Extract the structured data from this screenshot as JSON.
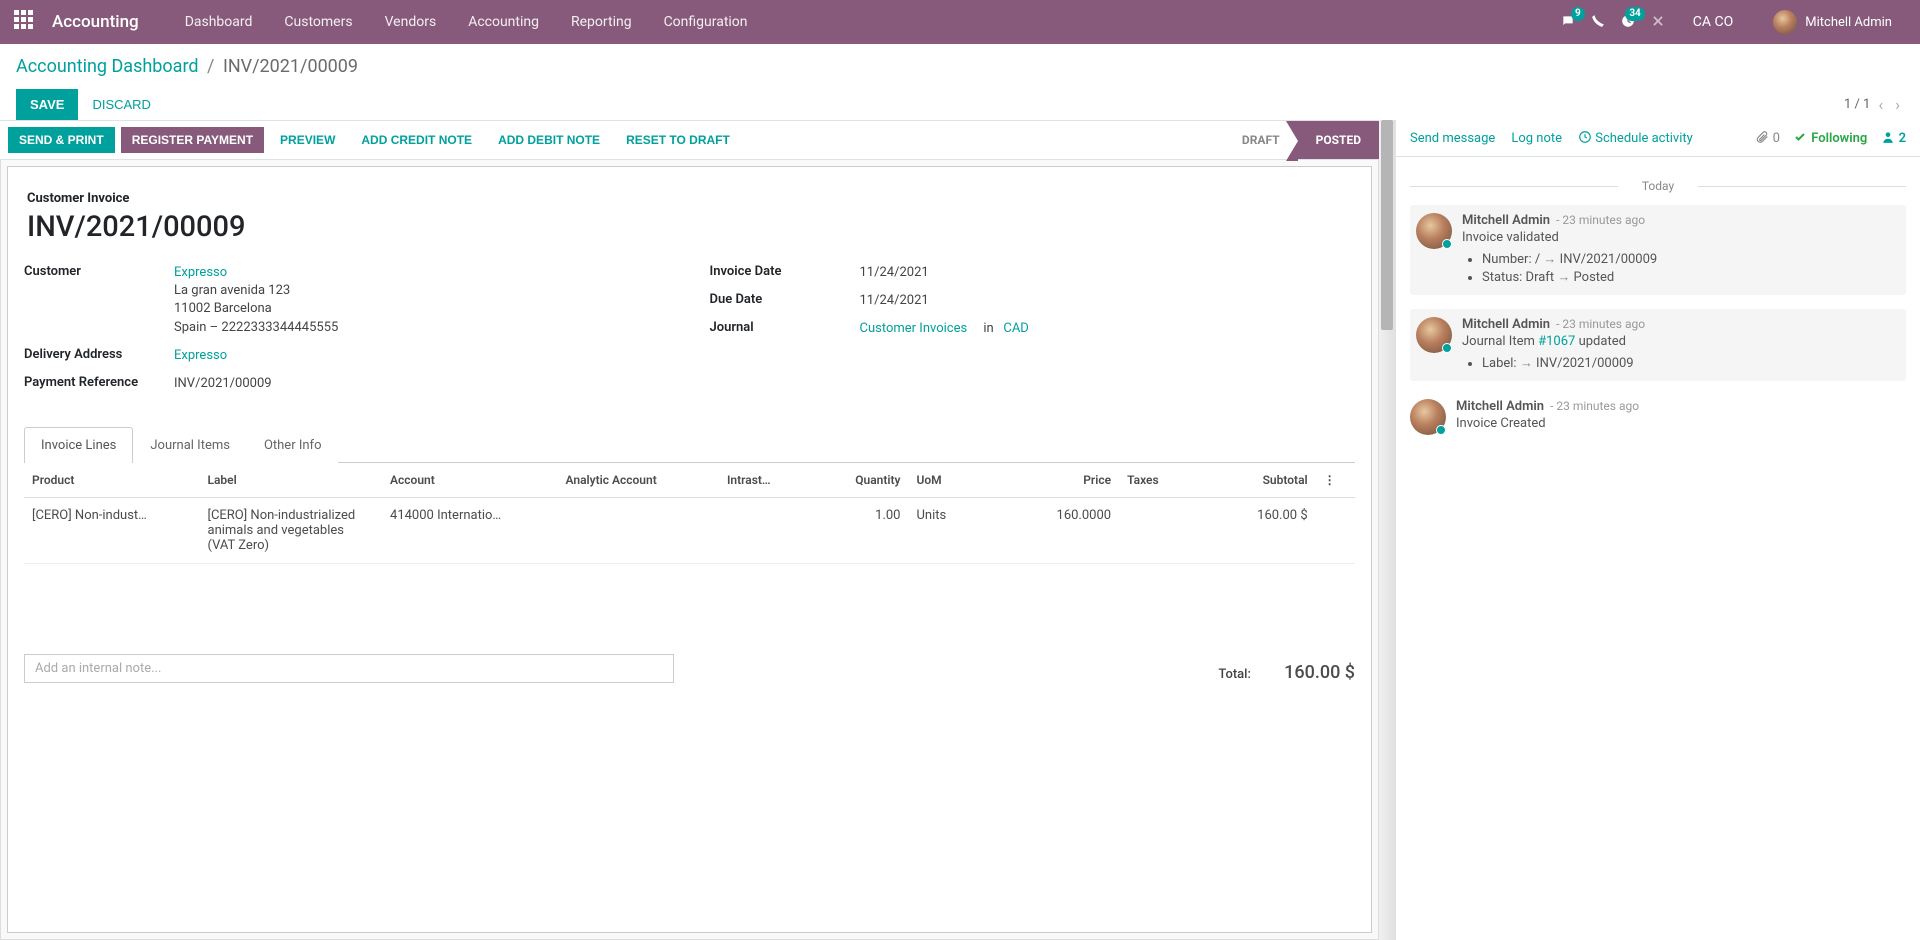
{
  "nav": {
    "app": "Accounting",
    "items": [
      "Dashboard",
      "Customers",
      "Vendors",
      "Accounting",
      "Reporting",
      "Configuration"
    ],
    "messages_count": "9",
    "activities_count": "34",
    "company": "CA CO",
    "user": "Mitchell Admin"
  },
  "breadcrumb": {
    "root": "Accounting Dashboard",
    "current": "INV/2021/00009"
  },
  "cmd": {
    "save": "SAVE",
    "discard": "DISCARD",
    "pager": "1 / 1"
  },
  "status": {
    "buttons": {
      "send_print": "SEND & PRINT",
      "register_payment": "REGISTER PAYMENT",
      "preview": "PREVIEW",
      "add_credit": "ADD CREDIT NOTE",
      "add_debit": "ADD DEBIT NOTE",
      "reset_draft": "RESET TO DRAFT"
    },
    "draft": "DRAFT",
    "posted": "POSTED"
  },
  "sheet": {
    "type": "Customer Invoice",
    "name": "INV/2021/00009",
    "labels": {
      "customer": "Customer",
      "delivery": "Delivery Address",
      "payref": "Payment Reference",
      "invoice_date": "Invoice Date",
      "due_date": "Due Date",
      "journal": "Journal"
    },
    "customer_name": "Expresso",
    "customer_addr1": "La gran avenida 123",
    "customer_addr2": "11002 Barcelona",
    "customer_addr3": "Spain – 2222333344445555",
    "delivery": "Expresso",
    "payref": "INV/2021/00009",
    "invoice_date": "11/24/2021",
    "due_date": "11/24/2021",
    "journal": "Customer Invoices",
    "journal_in": "in",
    "currency": "CAD"
  },
  "tabs": {
    "lines": "Invoice Lines",
    "journal": "Journal Items",
    "other": "Other Info"
  },
  "cols": {
    "product": "Product",
    "label": "Label",
    "account": "Account",
    "analytic": "Analytic Account",
    "intrastat": "Intrast…",
    "quantity": "Quantity",
    "uom": "UoM",
    "price": "Price",
    "taxes": "Taxes",
    "subtotal": "Subtotal"
  },
  "line": {
    "product": "[CERO] Non-indust…",
    "label": "[CERO] Non-industrialized animals and vegetables (VAT Zero)",
    "account": "414000 Internatio…",
    "qty": "1.00",
    "uom": "Units",
    "price": "160.0000",
    "subtotal": "160.00 $"
  },
  "note_placeholder": "Add an internal note...",
  "totals": {
    "label": "Total:",
    "value": "160.00 $"
  },
  "chatter": {
    "send": "Send message",
    "lognote": "Log note",
    "schedule": "Schedule activity",
    "attach_count": "0",
    "following": "Following",
    "followers": "2",
    "today": "Today",
    "msgs": {
      "m1": {
        "author": "Mitchell Admin",
        "time": "- 23 minutes ago",
        "text": "Invoice validated",
        "track1a": "Number: /",
        "track1b": "INV/2021/00009",
        "track2a": "Status: Draft",
        "track2b": "Posted"
      },
      "m2": {
        "author": "Mitchell Admin",
        "time": "- 23 minutes ago",
        "text_a": "Journal Item ",
        "text_link": "#1067",
        "text_b": " updated",
        "track1a": "Label:",
        "track1b": "INV/2021/00009"
      },
      "m3": {
        "author": "Mitchell Admin",
        "time": "- 23 minutes ago",
        "text": "Invoice Created"
      }
    }
  }
}
